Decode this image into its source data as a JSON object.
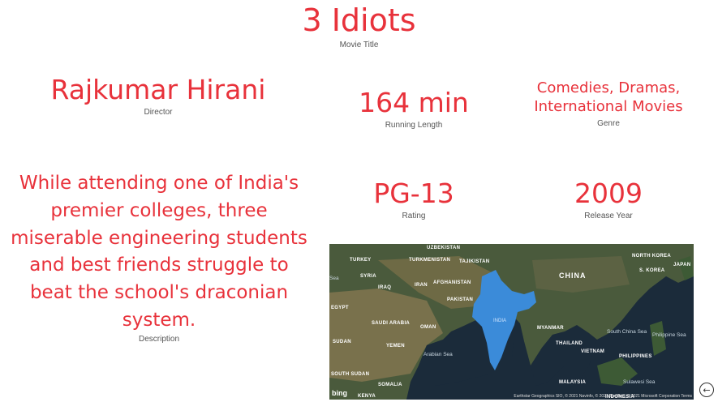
{
  "title": {
    "value": "3 Idiots",
    "label": "Movie Title"
  },
  "director": {
    "value": "Rajkumar Hirani",
    "label": "Director"
  },
  "running_length": {
    "value": "164 min",
    "label": "Running Length"
  },
  "genre": {
    "value": "Comedies, Dramas, International Movies",
    "label": "Genre"
  },
  "rating": {
    "value": "PG-13",
    "label": "Rating"
  },
  "release_year": {
    "value": "2009",
    "label": "Release Year"
  },
  "description": {
    "value": "While attending one of India's premier colleges, three miserable engineering students and best friends struggle to beat the school's draconian system.",
    "label": "Description"
  },
  "map": {
    "highlight_color": "#3b8bd9",
    "highlighted_country": "INDIA",
    "country_labels": [
      "UZBEKISTAN",
      "TURKMENISTAN",
      "TAJIKISTAN",
      "TURKEY",
      "SYRIA",
      "IRAQ",
      "IRAN",
      "AFGHANISTAN",
      "PAKISTAN",
      "EGYPT",
      "SAUDI ARABIA",
      "OMAN",
      "SUDAN",
      "YEMEN",
      "SOUTH SUDAN",
      "SOMALIA",
      "KENYA",
      "CHINA",
      "NORTH KOREA",
      "S. KOREA",
      "JAPAN",
      "MYANMAR",
      "THAILAND",
      "VIETNAM",
      "PHILIPPINES",
      "MALAYSIA",
      "INDONESIA"
    ],
    "sea_labels": [
      "Sea",
      "Arabian Sea",
      "South China Sea",
      "Philippine Sea",
      "Sulawesi Sea"
    ],
    "attribution": "Earthstar Geographics SIO, © 2021 Navinfo, © 2021 TomTom, © 2021 Microsoft Corporation  Terms",
    "logo": "bing"
  },
  "nav": {
    "back_icon": "arrow-left-circle-icon",
    "back_glyph": "←"
  }
}
